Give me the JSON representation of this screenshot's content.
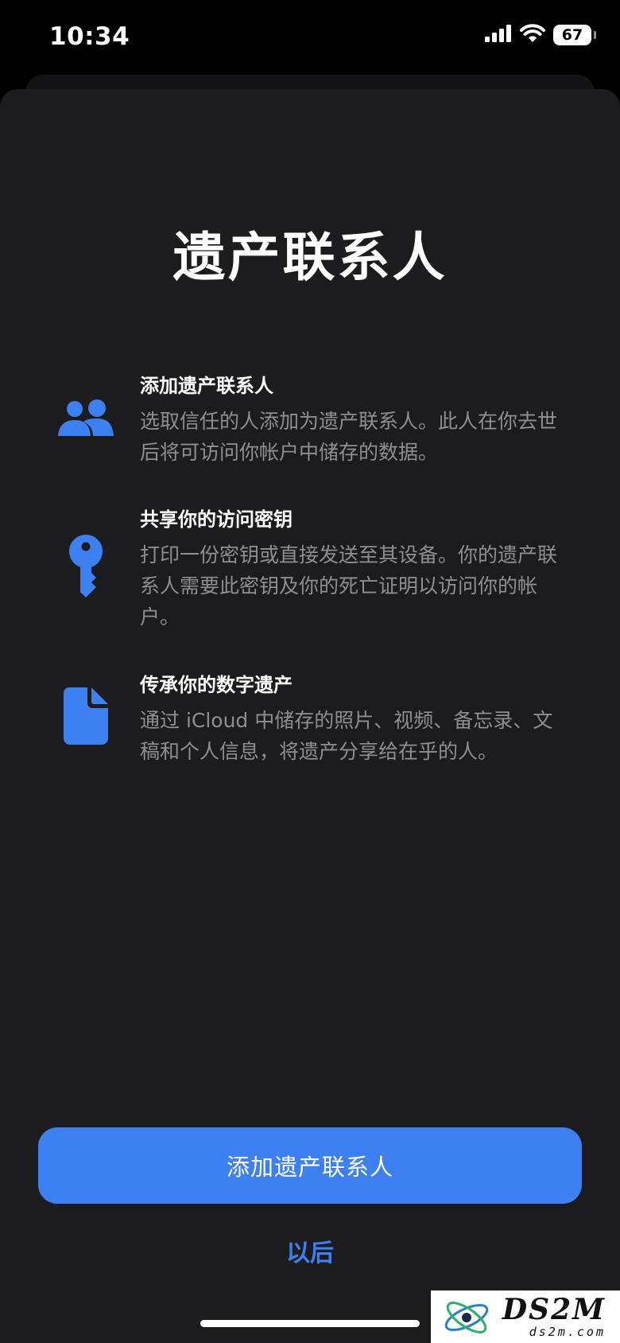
{
  "status_bar": {
    "time": "10:34",
    "battery_level": "67"
  },
  "page": {
    "title": "遗产联系人"
  },
  "features": [
    {
      "icon": "people-icon",
      "title": "添加遗产联系人",
      "description": "选取信任的人添加为遗产联系人。此人在你去世后将可访问你帐户中储存的数据。"
    },
    {
      "icon": "key-icon",
      "title": "共享你的访问密钥",
      "description": "打印一份密钥或直接发送至其设备。你的遗产联系人需要此密钥及你的死亡证明以访问你的帐户。"
    },
    {
      "icon": "document-icon",
      "title": "传承你的数字遗产",
      "description": "通过 iCloud 中储存的照片、视频、备忘录、文稿和个人信息，将遗产分享给在乎的人。"
    }
  ],
  "actions": {
    "primary_label": "添加遗产联系人",
    "secondary_label": "以后"
  },
  "watermark": {
    "logo_text": "DS2M",
    "url_text": "ds2m.com"
  },
  "colors": {
    "accent": "#3d80f1",
    "sheet_background": "#1c1c1e",
    "secondary_text": "#8e8e93"
  }
}
